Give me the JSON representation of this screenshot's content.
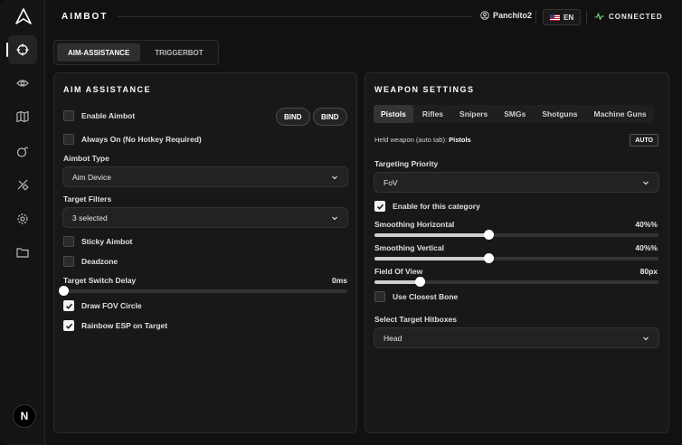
{
  "header": {
    "title": "AIMBOT",
    "username": "Panchito2",
    "language": "EN",
    "status": "CONNECTED"
  },
  "sidebar": {
    "items": [
      {
        "icon": "crosshair-icon",
        "active": true
      },
      {
        "icon": "eye-icon",
        "active": false
      },
      {
        "icon": "map-icon",
        "active": false
      },
      {
        "icon": "grenade-icon",
        "active": false
      },
      {
        "icon": "satellite-icon",
        "active": false
      },
      {
        "icon": "gear-icon",
        "active": false
      },
      {
        "icon": "folder-icon",
        "active": false
      }
    ],
    "avatar_letter": "N"
  },
  "tabs": [
    {
      "label": "AIM-ASSISTANCE",
      "active": true
    },
    {
      "label": "TRIGGERBOT",
      "active": false
    }
  ],
  "aim_assistance": {
    "title": "AIM ASSISTANCE",
    "enable_aimbot": {
      "label": "Enable Aimbot",
      "checked": false
    },
    "bind_1": "BIND",
    "bind_2": "BIND",
    "always_on": {
      "label": "Always On (No Hotkey Required)",
      "checked": false
    },
    "aimbot_type_label": "Aimbot Type",
    "aimbot_type_value": "Aim Device",
    "target_filters_label": "Target Filters",
    "target_filters_value": "3 selected",
    "sticky_aimbot": {
      "label": "Sticky Aimbot",
      "checked": false
    },
    "deadzone": {
      "label": "Deadzone",
      "checked": false
    },
    "switch_delay_label": "Target Switch Delay",
    "switch_delay_value": "0ms",
    "switch_delay_fraction": 0.0,
    "draw_fov": {
      "label": "Draw FOV Circle",
      "checked": true
    },
    "rainbow_esp": {
      "label": "Rainbow ESP on Target",
      "checked": true
    }
  },
  "weapon_settings": {
    "title": "WEAPON SETTINGS",
    "categories": [
      {
        "label": "Pistols",
        "active": true
      },
      {
        "label": "Rifles",
        "active": false
      },
      {
        "label": "Snipers",
        "active": false
      },
      {
        "label": "SMGs",
        "active": false
      },
      {
        "label": "Shotguns",
        "active": false
      },
      {
        "label": "Machine Guns",
        "active": false
      }
    ],
    "held_prefix": "Held weapon (auto tab): ",
    "held_value": "Pistols",
    "auto_label": "AUTO",
    "targeting_priority_label": "Targeting Priority",
    "targeting_priority_value": "FoV",
    "enable_category": {
      "label": "Enable for this category",
      "checked": true
    },
    "smoothing_h_label": "Smoothing Horizontal",
    "smoothing_h_value": "40%%",
    "smoothing_h_fraction": 0.4,
    "smoothing_v_label": "Smoothing Vertical",
    "smoothing_v_value": "40%%",
    "smoothing_v_fraction": 0.4,
    "fov_label": "Field Of View",
    "fov_value": "80px",
    "fov_fraction": 0.16,
    "closest_bone": {
      "label": "Use Closest Bone",
      "checked": false
    },
    "hitboxes_label": "Select Target Hitboxes",
    "hitboxes_value": "Head"
  }
}
